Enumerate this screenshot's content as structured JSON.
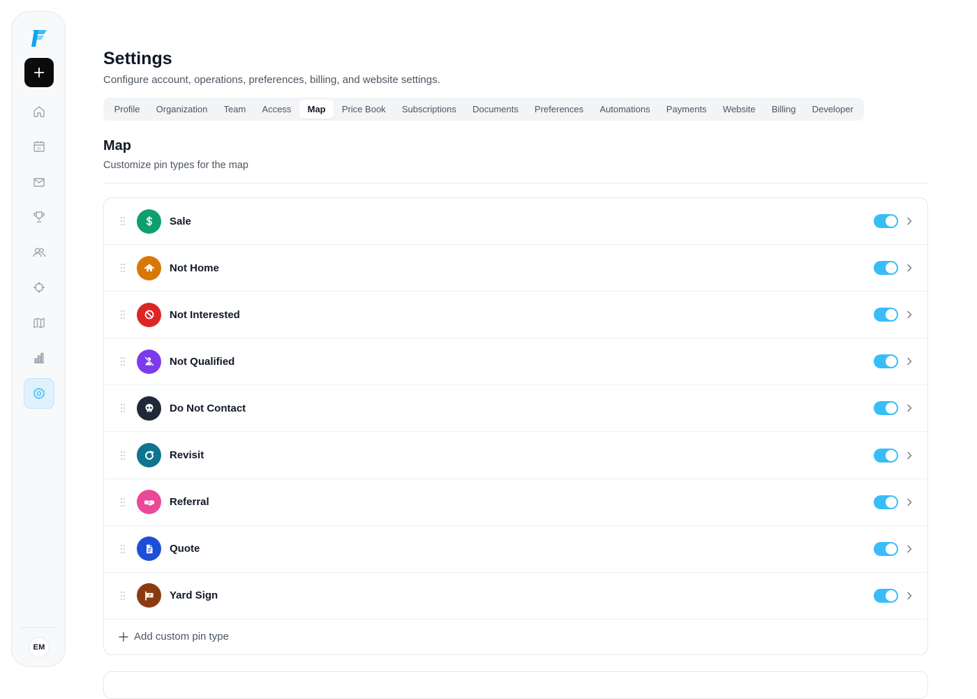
{
  "sidebar": {
    "logo": "fieldflow-logo",
    "new_button_icon": "plus-icon",
    "nav": [
      {
        "name": "home",
        "icon": "home-icon"
      },
      {
        "name": "calendar",
        "icon": "calendar-icon"
      },
      {
        "name": "messages",
        "icon": "mail-icon"
      },
      {
        "name": "leaderboard",
        "icon": "trophy-icon"
      },
      {
        "name": "team",
        "icon": "users-icon"
      },
      {
        "name": "territories",
        "icon": "crosshair-icon"
      },
      {
        "name": "map",
        "icon": "map-icon"
      },
      {
        "name": "reports",
        "icon": "bar-chart-icon"
      },
      {
        "name": "settings",
        "icon": "gear-icon",
        "active": true
      }
    ],
    "avatar_initials": "EM"
  },
  "header": {
    "title": "Settings",
    "subtitle": "Configure account, operations, preferences, billing, and website settings."
  },
  "tabs": [
    {
      "label": "Profile"
    },
    {
      "label": "Organization"
    },
    {
      "label": "Team"
    },
    {
      "label": "Access"
    },
    {
      "label": "Map",
      "active": true
    },
    {
      "label": "Price Book"
    },
    {
      "label": "Subscriptions"
    },
    {
      "label": "Documents"
    },
    {
      "label": "Preferences"
    },
    {
      "label": "Automations"
    },
    {
      "label": "Payments"
    },
    {
      "label": "Website"
    },
    {
      "label": "Billing"
    },
    {
      "label": "Developer"
    }
  ],
  "section": {
    "title": "Map",
    "subtitle": "Customize pin types for the map"
  },
  "pin_types": [
    {
      "label": "Sale",
      "icon": "dollar-icon",
      "color": "#0e9f6e",
      "enabled": true
    },
    {
      "label": "Not Home",
      "icon": "home-icon",
      "color": "#d97706",
      "enabled": true
    },
    {
      "label": "Not Interested",
      "icon": "ban-icon",
      "color": "#dc2626",
      "enabled": true
    },
    {
      "label": "Not Qualified",
      "icon": "user-slash-icon",
      "color": "#7c3aed",
      "enabled": true
    },
    {
      "label": "Do Not Contact",
      "icon": "skull-icon",
      "color": "#1f2937",
      "enabled": true
    },
    {
      "label": "Revisit",
      "icon": "refresh-icon",
      "color": "#0e7490",
      "enabled": true
    },
    {
      "label": "Referral",
      "icon": "handshake-icon",
      "color": "#ec4899",
      "enabled": true
    },
    {
      "label": "Quote",
      "icon": "document-icon",
      "color": "#1d4ed8",
      "enabled": true
    },
    {
      "label": "Yard Sign",
      "icon": "sign-icon",
      "color": "#8b3a0f",
      "enabled": true
    }
  ],
  "add_pin_label": "Add custom pin type",
  "colors": {
    "accent": "#38bdf8",
    "active_nav_bg": "#dff1fb"
  }
}
